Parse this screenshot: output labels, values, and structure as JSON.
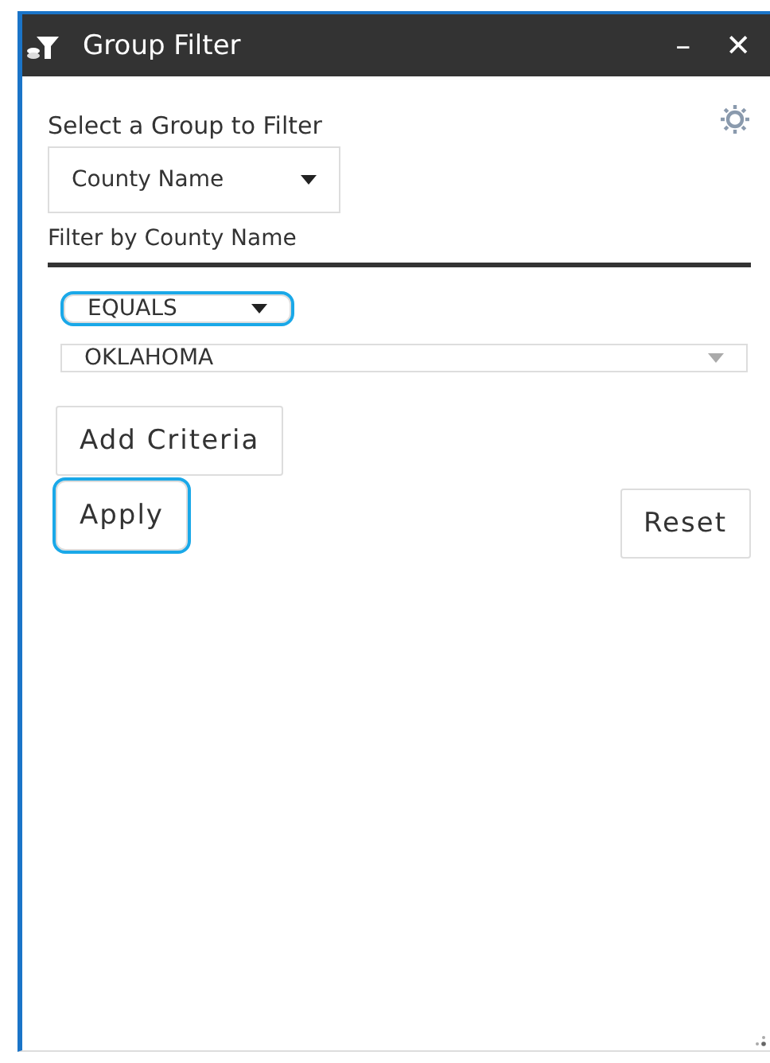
{
  "window": {
    "title": "Group Filter",
    "minimize": "–",
    "close": "✕"
  },
  "group_label": "Select a Group to Filter",
  "group_select": {
    "value": "County Name"
  },
  "filter_heading": "Filter by County Name",
  "operator_select": {
    "value": "EQUALS",
    "highlighted": true
  },
  "value_select": {
    "value": "OKLAHOMA"
  },
  "buttons": [
    {
      "kind": "add",
      "label": "Add Criteria",
      "highlighted": false
    },
    {
      "kind": "apply",
      "label": "Apply",
      "highlighted": true
    },
    {
      "kind": "reset",
      "label": "Reset",
      "highlighted": false
    }
  ]
}
